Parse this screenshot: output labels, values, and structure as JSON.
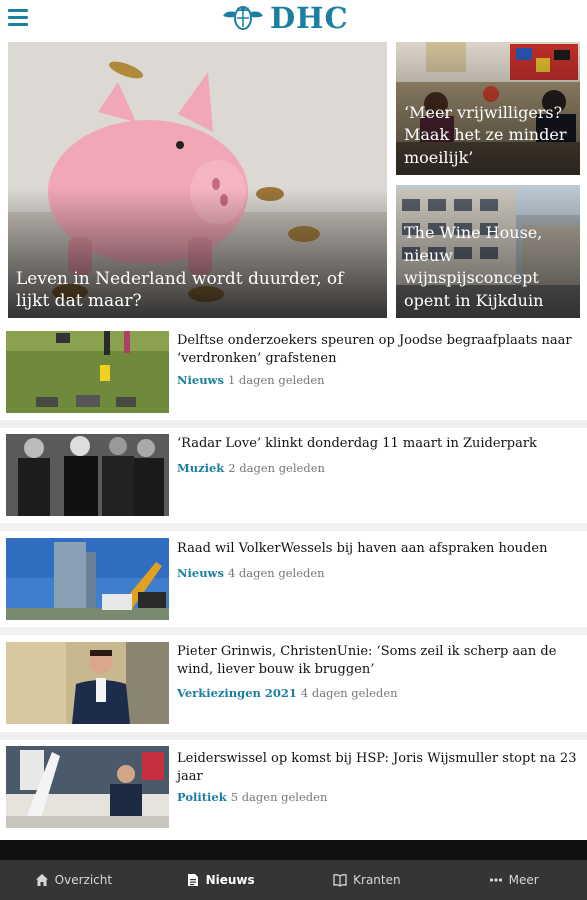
{
  "header": {
    "logo_text": "DHC"
  },
  "hero": {
    "main": {
      "title": "Leven in Nederland wordt duurder, of lijkt dat maar?"
    },
    "side": [
      {
        "title": "‘Meer vrijwilligers? Maak het ze minder moeilijk’"
      },
      {
        "title": "The Wine House, nieuw wijnspijsconcept opent in Kijkduin"
      }
    ]
  },
  "articles": [
    {
      "title": "Delftse onderzoekers speuren op Joodse begraafplaats naar ‘verdronken’ grafstenen",
      "category": "Nieuws",
      "time": "1 dagen geleden"
    },
    {
      "title": "‘Radar Love’ klinkt donderdag 11 maart in Zuiderpark",
      "category": "Muziek",
      "time": "2 dagen geleden"
    },
    {
      "title": "Raad wil VolkerWessels bij haven aan afspraken houden",
      "category": "Nieuws",
      "time": "4 dagen geleden"
    },
    {
      "title": "Pieter Grinwis, ChristenUnie: ‘Soms zeil ik scherp aan de wind, liever bouw ik bruggen’",
      "category": "Verkiezingen 2021",
      "time": "4 dagen geleden"
    },
    {
      "title": "Leiderswissel op komst bij HSP: Joris Wijsmuller stopt na 23 jaar",
      "category": "Politiek",
      "time": "5 dagen geleden"
    }
  ],
  "bottom_nav": {
    "items": [
      {
        "label": "Overzicht",
        "icon": "home-icon"
      },
      {
        "label": "Nieuws",
        "icon": "news-icon"
      },
      {
        "label": "Kranten",
        "icon": "book-icon"
      },
      {
        "label": "Meer",
        "icon": "more-icon"
      }
    ],
    "active": "Nieuws"
  },
  "colors": {
    "accent": "#1a7fa0",
    "nav_background": "#353535"
  }
}
